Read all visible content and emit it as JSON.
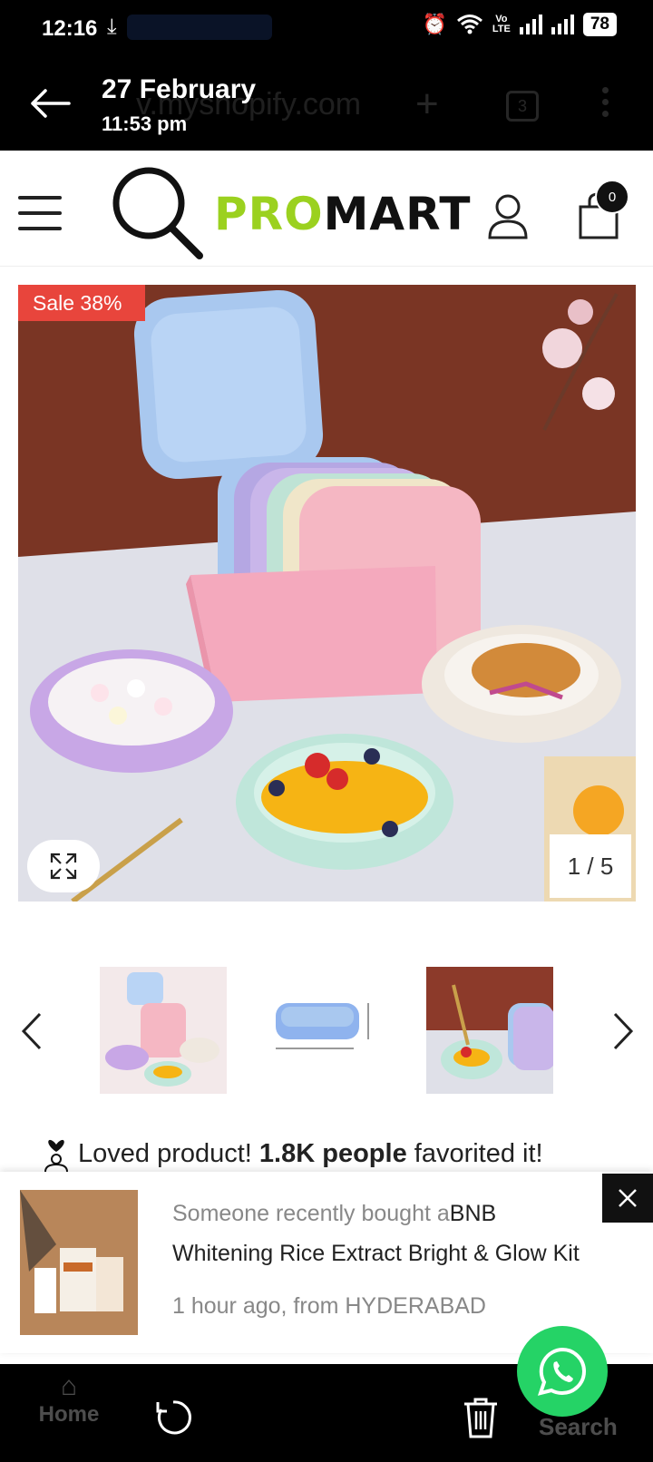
{
  "status_bar": {
    "time": "12:16",
    "volte": "Vo\nLTE",
    "battery": "78"
  },
  "viewer": {
    "date": "27 February",
    "time": "11:53 pm",
    "ghost_url": "v.myshopify.com",
    "ghost_tabs": "3"
  },
  "store": {
    "logo_green": "PRO",
    "logo_dark": "MART",
    "cart_count": "0"
  },
  "product": {
    "sale_badge": "Sale 38%",
    "image_counter": "1 / 5"
  },
  "social_proof": {
    "prefix": "Loved product! ",
    "count": "1.8K people",
    "suffix": " favorited it!"
  },
  "popup": {
    "prefix": "Someone recently bought a",
    "brand": "BNB",
    "product": "Whitening Rice Extract Bright & Glow Kit",
    "meta": "1 hour ago, from HYDERABAD"
  },
  "bottom_bar": {
    "home_label": "Home",
    "search_label": "Search"
  },
  "colors": {
    "accent_green": "#9bd11f",
    "sale_red": "#e8453c",
    "whatsapp_green": "#25d366"
  }
}
